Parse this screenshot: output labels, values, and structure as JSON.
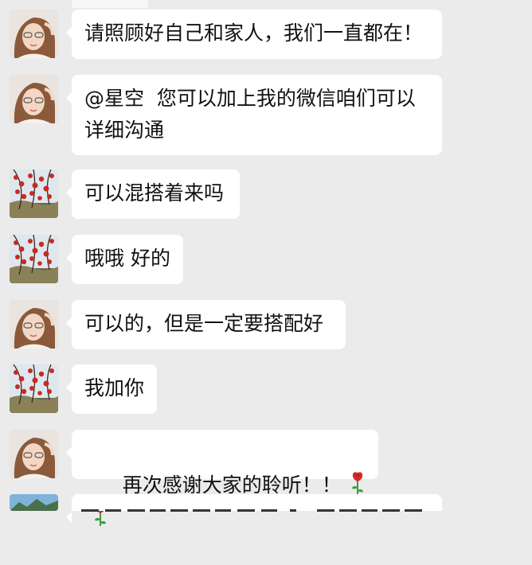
{
  "chat": {
    "messages": [
      {
        "sender": "woman",
        "text": "请照顾好自己和家人，我们一直都在！"
      },
      {
        "sender": "woman",
        "text": "@星空  您可以加上我的微信咱们可以\n详细沟通"
      },
      {
        "sender": "autumn",
        "text": "可以混搭着来吗"
      },
      {
        "sender": "autumn",
        "text": "哦哦 好的"
      },
      {
        "sender": "woman",
        "text": "可以的，但是一定要搭配好"
      },
      {
        "sender": "autumn",
        "text": "我加你"
      },
      {
        "sender": "woman",
        "text": "再次感谢大家的聆听！！",
        "emojis": [
          "rose-icon",
          "rose-icon"
        ]
      }
    ]
  },
  "colors": {
    "background": "#ebebeb",
    "bubble": "#ffffff",
    "text": "#111111",
    "rose": "#d42a2a"
  }
}
